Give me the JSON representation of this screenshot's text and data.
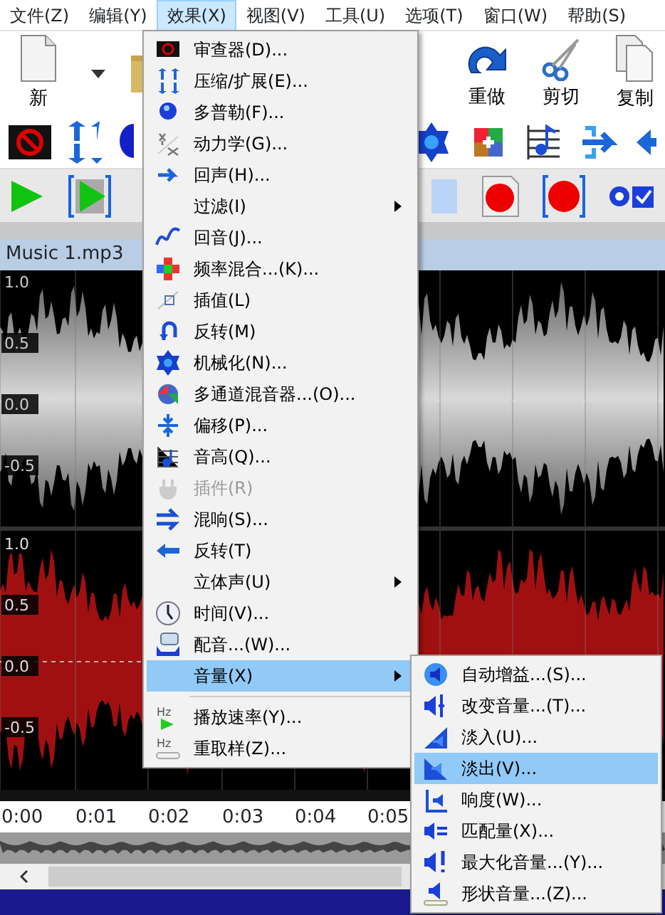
{
  "menubar": [
    {
      "label": "文件(Z)",
      "selected": false
    },
    {
      "label": "编辑(Y)",
      "selected": false
    },
    {
      "label": "效果(X)",
      "selected": true
    },
    {
      "label": "视图(V)",
      "selected": false
    },
    {
      "label": "工具(U)",
      "selected": false
    },
    {
      "label": "选项(T)",
      "selected": false
    },
    {
      "label": "窗口(W)",
      "selected": false
    },
    {
      "label": "帮助(S)",
      "selected": false
    }
  ],
  "main_toolbar": {
    "left": [
      {
        "label": "新"
      }
    ],
    "right": [
      {
        "label": "重做"
      },
      {
        "label": "剪切"
      },
      {
        "label": "复制"
      }
    ]
  },
  "document_tab": {
    "title": "Music 1.mp3"
  },
  "waveform": {
    "top_labels": [
      "1.0",
      "0.5",
      "0.0",
      "-0.5"
    ],
    "bottom_labels": [
      "1.0",
      "0.5",
      "0.0",
      "-0.5"
    ]
  },
  "timeline": [
    "0:00",
    "0:01",
    "0:02",
    "0:03",
    "0:04",
    "0:05"
  ],
  "effects_menu": [
    {
      "kind": "item",
      "label": "审查器(D)...",
      "disabled": false,
      "submenu": false,
      "selected": false
    },
    {
      "kind": "item",
      "label": "压缩/扩展(E)...",
      "disabled": false,
      "submenu": false,
      "selected": false
    },
    {
      "kind": "item",
      "label": "多普勒(F)...",
      "disabled": false,
      "submenu": false,
      "selected": false
    },
    {
      "kind": "item",
      "label": "动力学(G)...",
      "disabled": false,
      "submenu": false,
      "selected": false
    },
    {
      "kind": "item",
      "label": "回声(H)...",
      "disabled": false,
      "submenu": false,
      "selected": false
    },
    {
      "kind": "item",
      "label": "过滤(I)",
      "disabled": false,
      "submenu": true,
      "selected": false
    },
    {
      "kind": "item",
      "label": "回音(J)...",
      "disabled": false,
      "submenu": false,
      "selected": false
    },
    {
      "kind": "item",
      "label": "频率混合...(K)...",
      "disabled": false,
      "submenu": false,
      "selected": false
    },
    {
      "kind": "item",
      "label": "插值(L)",
      "disabled": false,
      "submenu": false,
      "selected": false
    },
    {
      "kind": "item",
      "label": "反转(M)",
      "disabled": false,
      "submenu": false,
      "selected": false
    },
    {
      "kind": "item",
      "label": "机械化(N)...",
      "disabled": false,
      "submenu": false,
      "selected": false
    },
    {
      "kind": "item",
      "label": "多通道混音器...(O)...",
      "disabled": false,
      "submenu": false,
      "selected": false
    },
    {
      "kind": "item",
      "label": "偏移(P)...",
      "disabled": false,
      "submenu": false,
      "selected": false
    },
    {
      "kind": "item",
      "label": "音高(Q)...",
      "disabled": false,
      "submenu": false,
      "selected": false
    },
    {
      "kind": "item",
      "label": "插件(R)",
      "disabled": true,
      "submenu": false,
      "selected": false
    },
    {
      "kind": "item",
      "label": "混响(S)...",
      "disabled": false,
      "submenu": false,
      "selected": false
    },
    {
      "kind": "item",
      "label": "反转(T)",
      "disabled": false,
      "submenu": false,
      "selected": false
    },
    {
      "kind": "item",
      "label": "立体声(U)",
      "disabled": false,
      "submenu": true,
      "selected": false
    },
    {
      "kind": "item",
      "label": "时间(V)...",
      "disabled": false,
      "submenu": false,
      "selected": false
    },
    {
      "kind": "item",
      "label": "配音...(W)...",
      "disabled": false,
      "submenu": false,
      "selected": false
    },
    {
      "kind": "item",
      "label": "音量(X)",
      "disabled": false,
      "submenu": true,
      "selected": true
    },
    {
      "kind": "separator"
    },
    {
      "kind": "item",
      "label": "播放速率(Y)...",
      "icon_text": "Hz",
      "disabled": false,
      "submenu": false,
      "selected": false
    },
    {
      "kind": "item",
      "label": "重取样(Z)...",
      "icon_text": "Hz",
      "disabled": false,
      "submenu": false,
      "selected": false
    }
  ],
  "volume_submenu": [
    {
      "label": "自动增益...(S)...",
      "selected": false
    },
    {
      "label": "改变音量...(T)...",
      "selected": false
    },
    {
      "label": "淡入(U)...",
      "selected": false
    },
    {
      "label": "淡出(V)...",
      "selected": true
    },
    {
      "label": "响度(W)...",
      "selected": false
    },
    {
      "label": "匹配量(X)...",
      "selected": false
    },
    {
      "label": "最大化音量...(Y)...",
      "selected": false
    },
    {
      "label": "形状音量...(Z)...",
      "selected": false
    }
  ]
}
